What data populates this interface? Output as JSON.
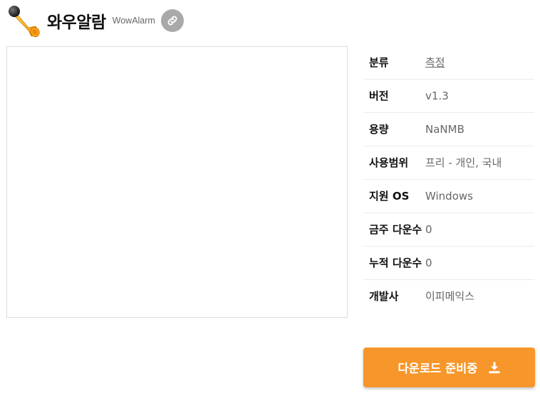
{
  "header": {
    "title": "와우알람",
    "subtitle": "WowAlarm",
    "app_icon": "air-horn-icon",
    "link_icon": "link-icon"
  },
  "info": {
    "rows": [
      {
        "key": "분류",
        "value": "측정"
      },
      {
        "key": "버전",
        "value": "v1.3"
      },
      {
        "key": "용량",
        "value": "NaNMB"
      },
      {
        "key": "사용범위",
        "value": "프리 - 개인, 국내"
      },
      {
        "key": "지원 OS",
        "value": "Windows"
      },
      {
        "key": "금주 다운수",
        "value": "0"
      },
      {
        "key": "누적 다운수",
        "value": "0"
      },
      {
        "key": "개발사",
        "value": "이피메익스"
      }
    ]
  },
  "download": {
    "label": "다운로드 준비중",
    "icon": "download-icon"
  },
  "colors": {
    "accent": "#f7962b",
    "link_button": "#a9a9a9"
  }
}
